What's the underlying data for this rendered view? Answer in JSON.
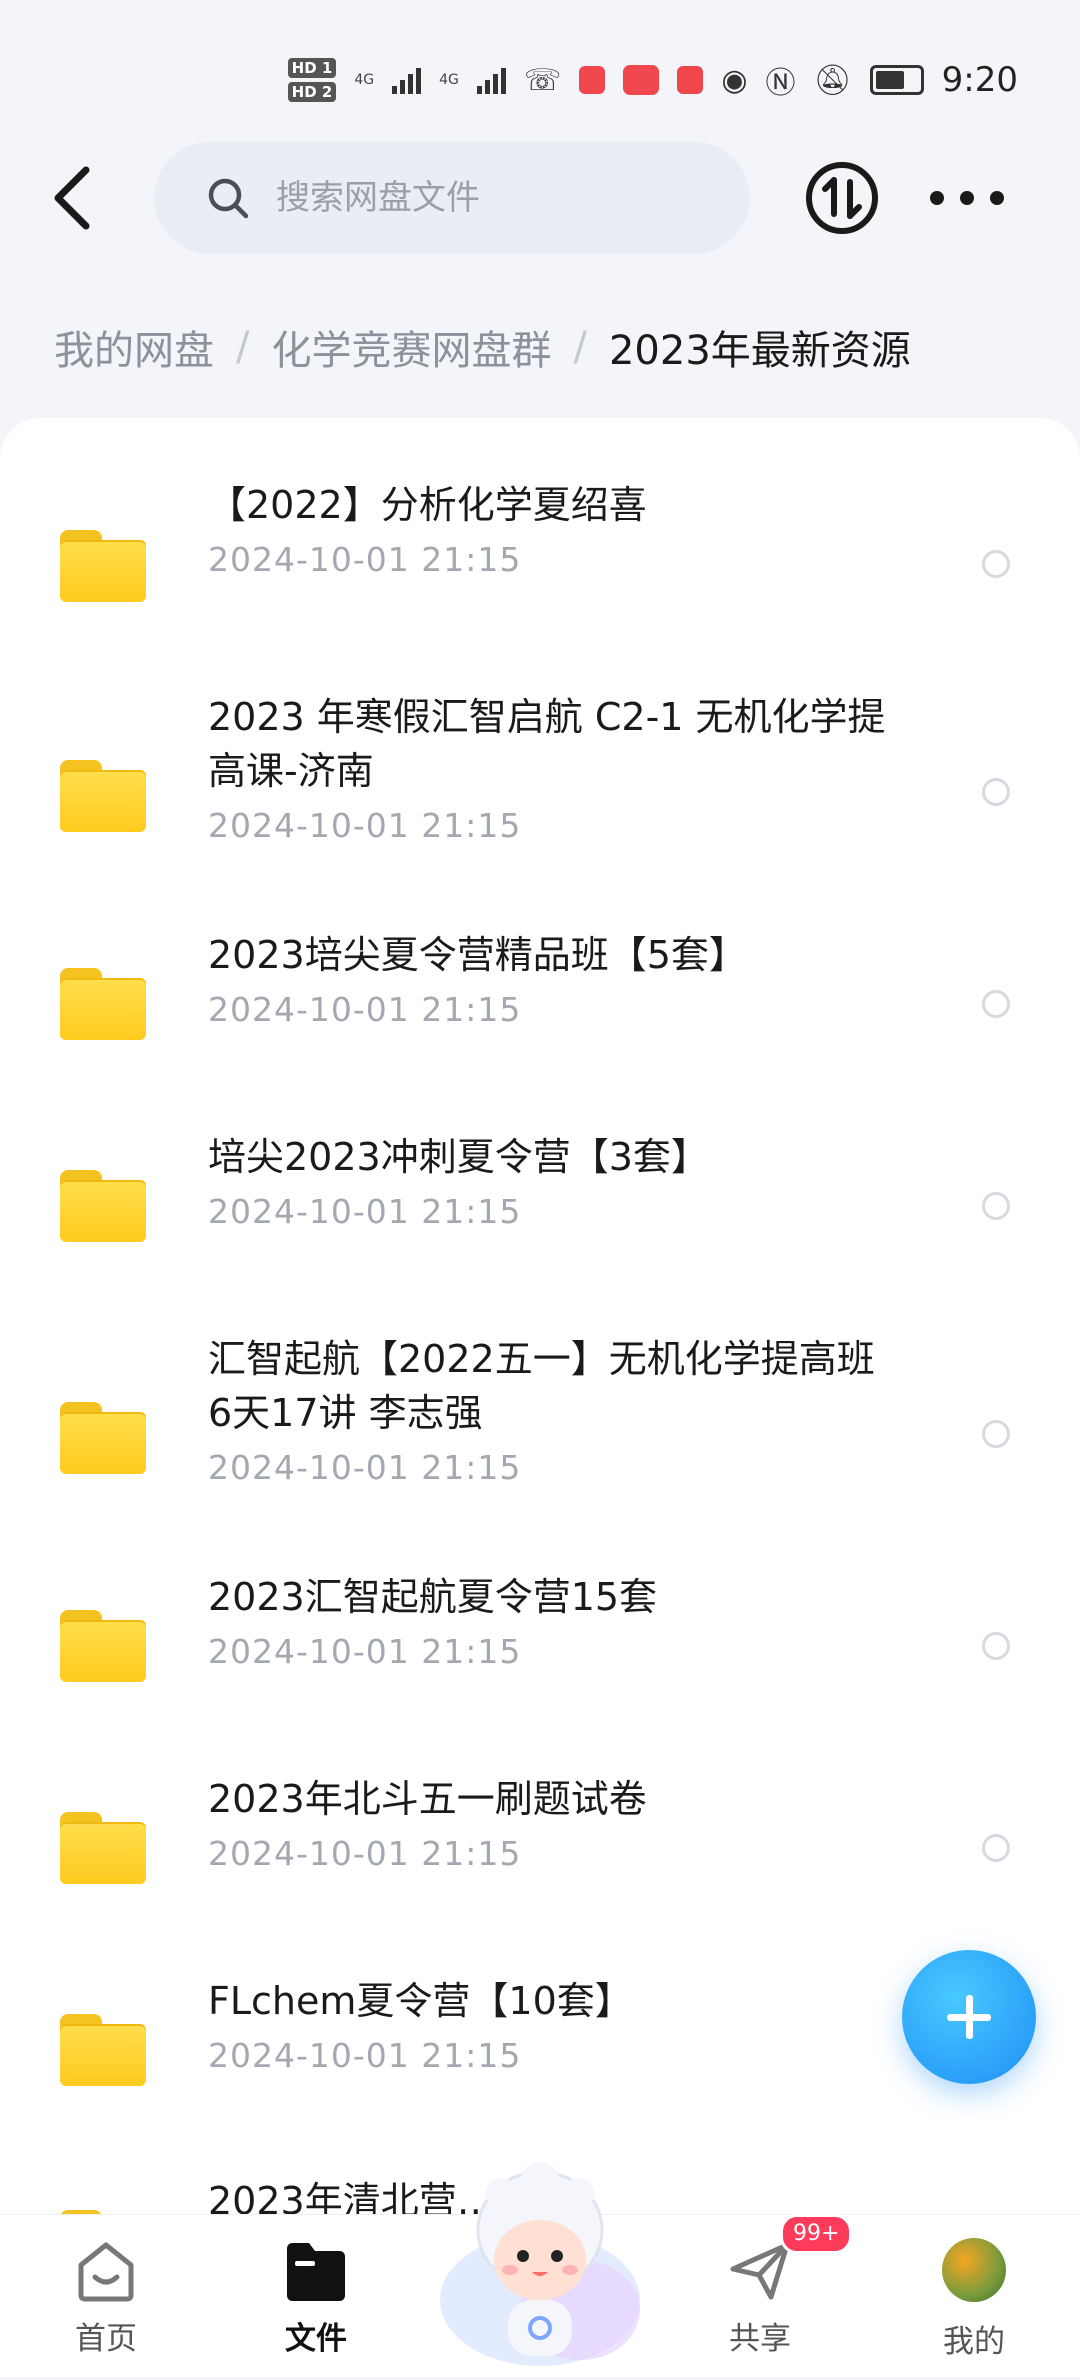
{
  "status_bar": {
    "hd1": "HD 1",
    "hd2": "HD 2",
    "net1": "4G",
    "net2": "4G",
    "time": "9:20"
  },
  "header": {
    "search_placeholder": "搜索网盘文件"
  },
  "breadcrumb": {
    "items": [
      "我的网盘",
      "化学竞赛网盘群"
    ],
    "separator": "/",
    "current": "2023年最新资源"
  },
  "files": [
    {
      "name": "【2022】分析化学夏绍喜",
      "date": "2024-10-01  21:15"
    },
    {
      "name": "2023 年寒假汇智启航 C2-1 无机化学提高课-济南",
      "date": "2024-10-01  21:15"
    },
    {
      "name": "2023培尖夏令营精品班【5套】",
      "date": "2024-10-01  21:15"
    },
    {
      "name": "培尖2023冲刺夏令营【3套】",
      "date": "2024-10-01  21:15"
    },
    {
      "name": "汇智起航【2022五一】无机化学提高班 6天17讲 李志强",
      "date": "2024-10-01  21:15"
    },
    {
      "name": "2023汇智起航夏令营15套",
      "date": "2024-10-01  21:15"
    },
    {
      "name": "2023年北斗五一刷题试卷",
      "date": "2024-10-01  21:15"
    },
    {
      "name": "FLchem夏令营【10套】",
      "date": "2024-10-01  21:15"
    },
    {
      "name": "2023年清北营……",
      "date": ""
    }
  ],
  "bottom_nav": {
    "home": "首页",
    "files": "文件",
    "share": "共享",
    "share_badge": "99+",
    "mine": "我的"
  },
  "colors": {
    "accent": "#1e8ff6",
    "folder": "#ffd23a",
    "badge": "#ff3b5b"
  }
}
